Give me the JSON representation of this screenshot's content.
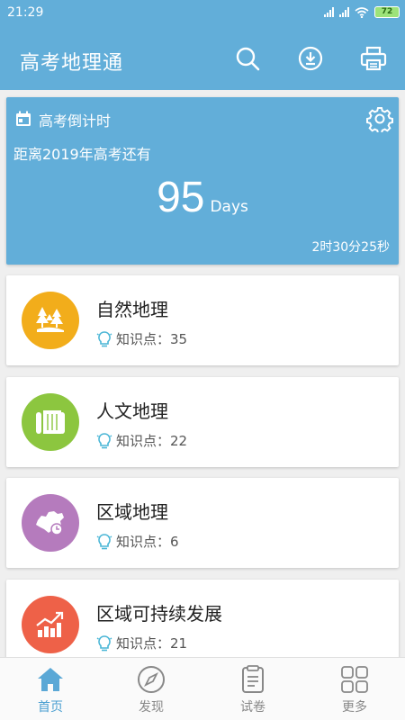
{
  "status_bar": {
    "time": "21:29",
    "battery": "72"
  },
  "app_bar": {
    "title": "高考地理通"
  },
  "countdown": {
    "title": "高考倒计时",
    "subtitle": "距离2019年高考还有",
    "days": "95",
    "days_unit": "Days",
    "time_left": "2时30分25秒"
  },
  "categories": [
    {
      "title": "自然地理",
      "points": "知识点：35",
      "color": "#f2ad1b",
      "icon": "forest-icon"
    },
    {
      "title": "人文地理",
      "points": "知识点：22",
      "color": "#8cc63f",
      "icon": "scroll-icon"
    },
    {
      "title": "区域地理",
      "points": "知识点：6",
      "color": "#b57bbd",
      "icon": "china-map-icon"
    },
    {
      "title": "区域可持续发展",
      "points": "知识点：21",
      "color": "#ee6148",
      "icon": "growth-chart-icon"
    }
  ],
  "bottom_nav": [
    {
      "label": "首页",
      "icon": "home-icon"
    },
    {
      "label": "发现",
      "icon": "compass-icon"
    },
    {
      "label": "试卷",
      "icon": "paper-icon"
    },
    {
      "label": "更多",
      "icon": "grid-icon"
    }
  ]
}
